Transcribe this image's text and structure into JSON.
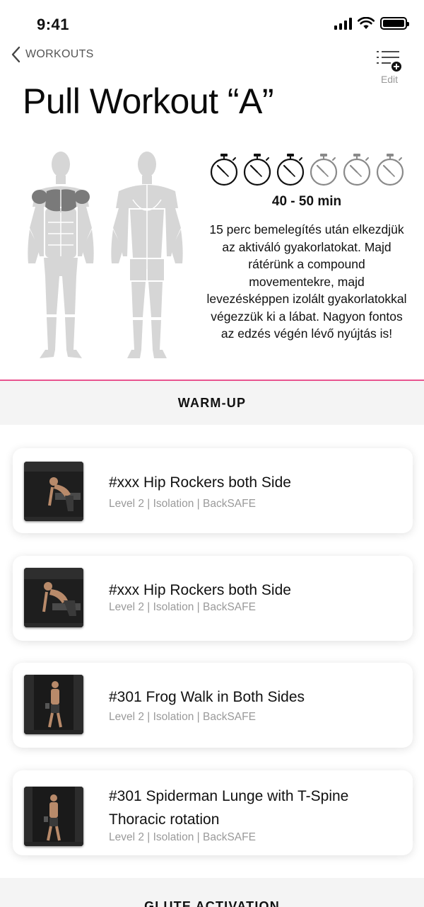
{
  "status_bar": {
    "time": "9:41"
  },
  "nav": {
    "back_label": "WORKOUTS",
    "edit_label": "Edit"
  },
  "header": {
    "title": "Pull Workout “A”"
  },
  "summary": {
    "duration": "40 - 50 min",
    "timers_total": 6,
    "timers_active": 3,
    "description": "15 perc bemelegítés után elkezdjük az aktiváló gyakorlatokat. Majd rátérünk a compound movementekre, majd levezésképpen izolált gyakorlatokkal végezzük ki a lábat. Nagyon fontos az edzés végén lévő nyújtás is!"
  },
  "colors": {
    "accent": "#e8548f",
    "muscle_active": "#7a7a7a",
    "muscle_idle": "#d6d6d6",
    "meta_text": "#9a9a9a"
  },
  "sections": [
    {
      "title": "WARM-UP",
      "exercises": [
        {
          "title": "#xxx Hip Rockers both Side",
          "meta": "Level 2 | Isolation | BackSAFE"
        },
        {
          "title": "#xxx Hip Rockers both Side",
          "meta": "Level 2 | Isolation | BackSAFE"
        },
        {
          "title": "#301 Frog Walk in Both Sides",
          "meta": "Level 2 | Isolation | BackSAFE"
        },
        {
          "title": "#301 Spiderman Lunge with T-Spine Thoracic rotation",
          "meta": "Level 2 | Isolation | BackSAFE"
        }
      ]
    },
    {
      "title": "GLUTE ACTIVATION"
    }
  ],
  "icons": {
    "back": "chevron-left-icon",
    "edit": "list-add-icon",
    "timer": "stopwatch-icon",
    "wifi": "wifi-icon",
    "signal": "cellular-signal-icon",
    "battery": "battery-icon"
  }
}
